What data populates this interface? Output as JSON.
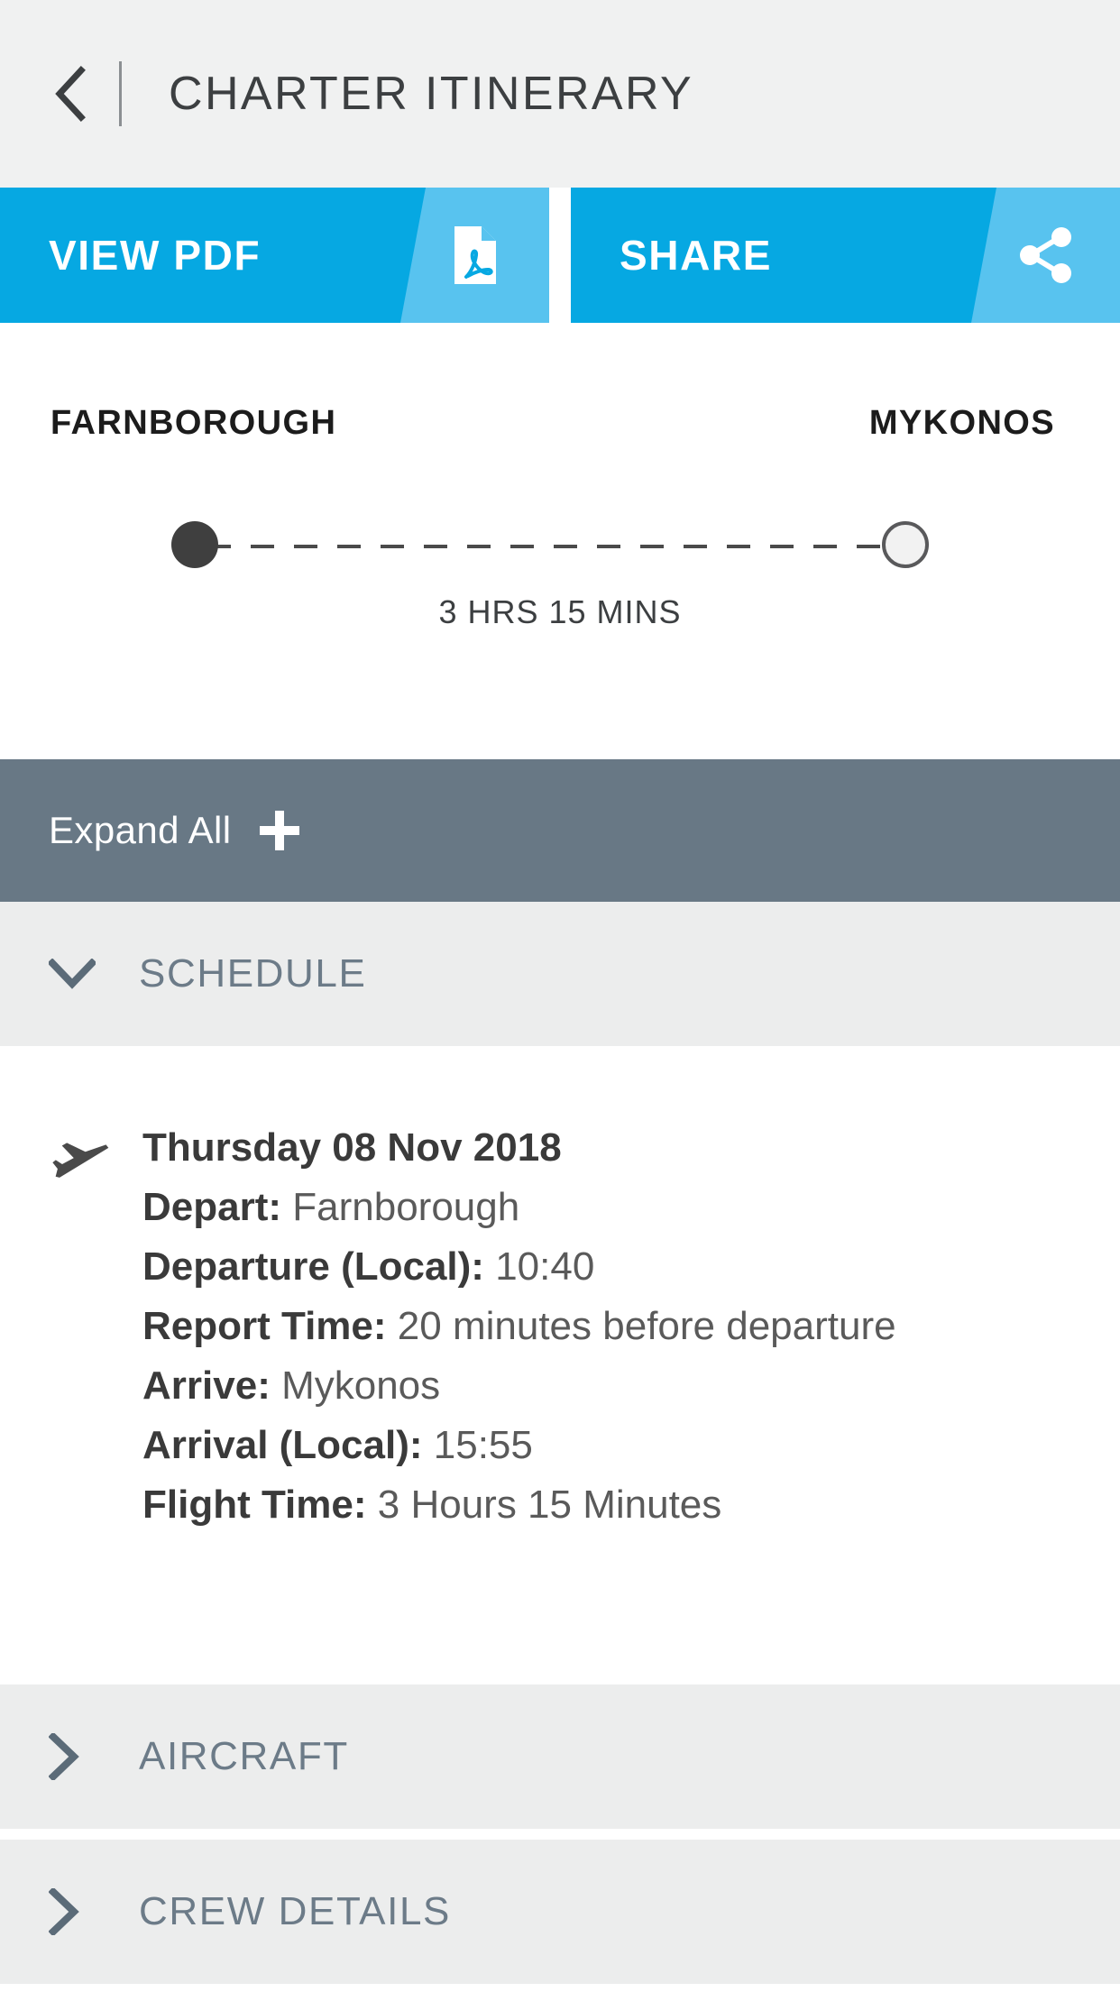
{
  "header": {
    "back_icon": "chevron-left-icon",
    "title": "CHARTER ITINERARY"
  },
  "actions": {
    "view_pdf": {
      "label": "VIEW PDF",
      "icon": "pdf-file-icon"
    },
    "share": {
      "label": "SHARE",
      "icon": "share-icon"
    }
  },
  "route": {
    "origin": "FARNBOROUGH",
    "destination": "MYKONOS",
    "duration": "3 HRS 15 MINS"
  },
  "expand_all": {
    "label": "Expand All",
    "icon": "plus-icon"
  },
  "sections": [
    {
      "id": "schedule",
      "title": "SCHEDULE",
      "expanded": true,
      "chevron": "chevron-down-icon"
    },
    {
      "id": "aircraft",
      "title": "AIRCRAFT",
      "expanded": false,
      "chevron": "chevron-right-icon"
    },
    {
      "id": "crew",
      "title": "CREW DETAILS",
      "expanded": false,
      "chevron": "chevron-right-icon"
    }
  ],
  "schedule": {
    "icon": "airplane-icon",
    "date": "Thursday 08 Nov 2018",
    "rows": [
      {
        "label": "Depart:",
        "value": "Farnborough"
      },
      {
        "label": "Departure (Local):",
        "value": "10:40"
      },
      {
        "label": "Report Time:",
        "value": "20 minutes before departure"
      },
      {
        "label": "Arrive:",
        "value": "Mykonos"
      },
      {
        "label": "Arrival (Local):",
        "value": "15:55"
      },
      {
        "label": "Flight Time:",
        "value": "3 Hours 15 Minutes"
      }
    ]
  },
  "colors": {
    "primary_blue": "#06a8e2",
    "accent_blue": "#58c3ef",
    "slate": "#687885",
    "header_bg": "#f0f1f1",
    "section_bg": "#eceded",
    "section_text": "#6c7b88"
  }
}
